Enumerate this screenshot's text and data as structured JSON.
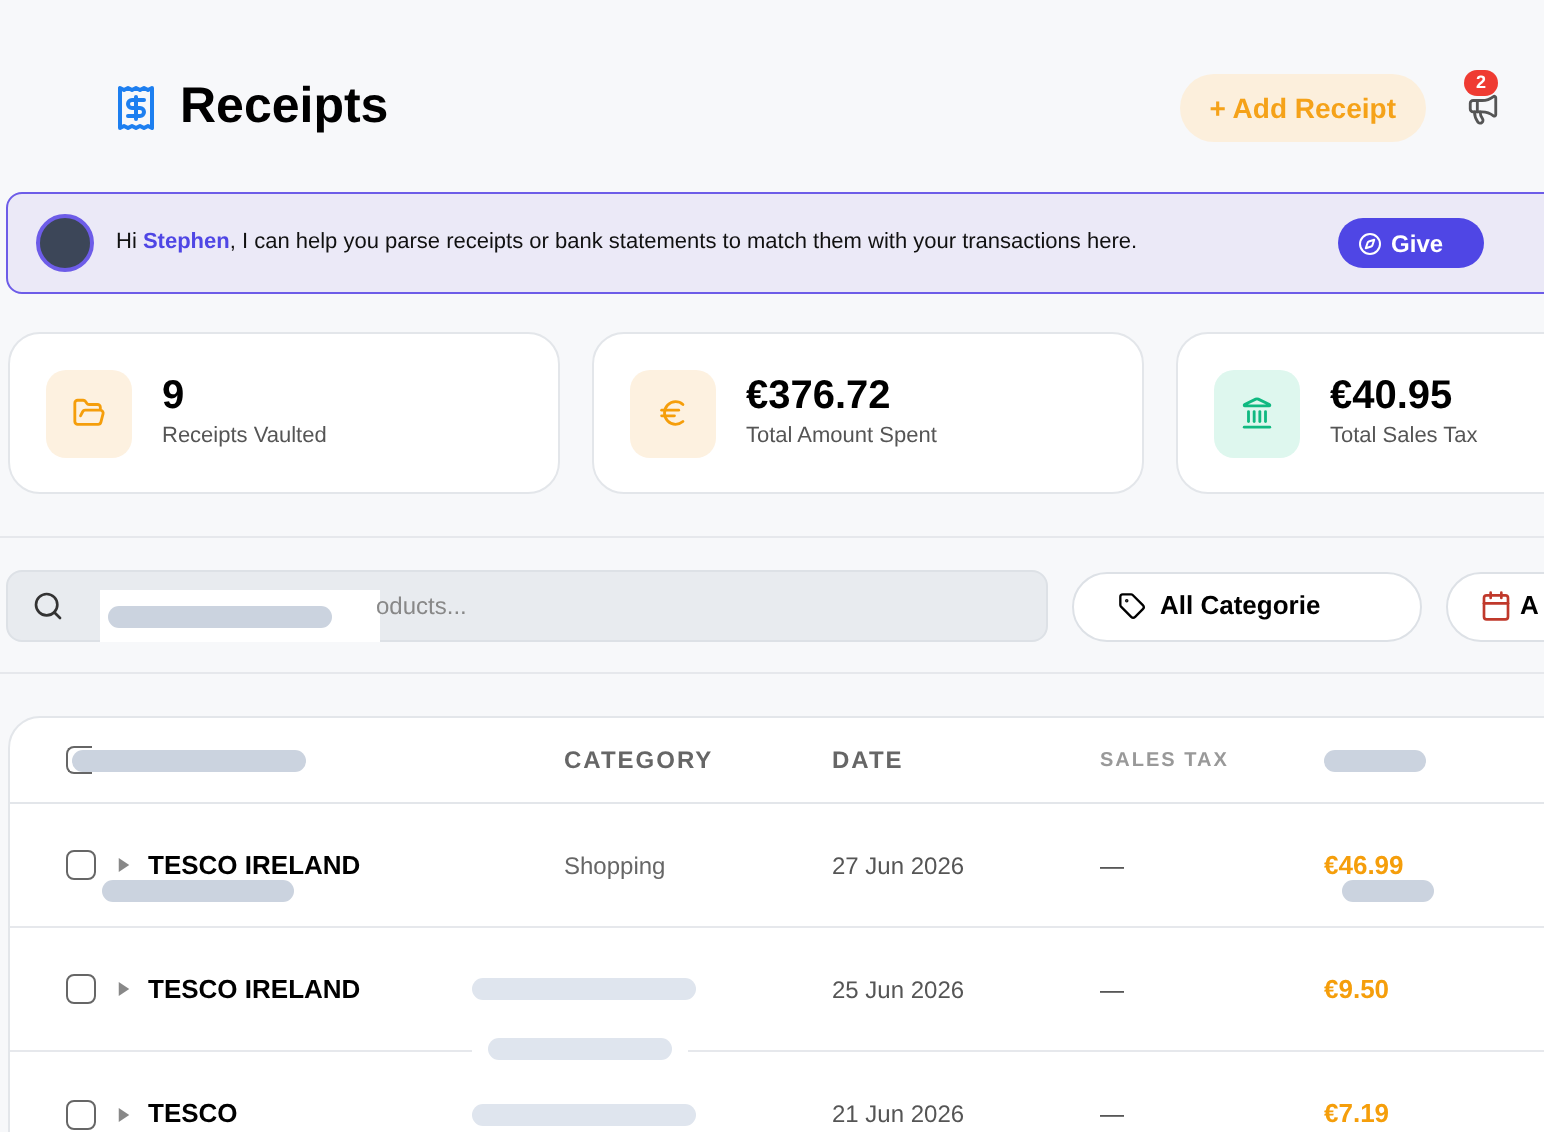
{
  "header": {
    "title": "Receipts",
    "add_button": "+ Add Receipt",
    "notifications": {
      "count": "2"
    }
  },
  "banner": {
    "message": "Hi **Stephen**, I can help you parse receipts or bank statements to match them with your transactions here.",
    "button": "Give"
  },
  "stats": [
    {
      "kind": "folder",
      "value": "9",
      "label": "Receipts Vaulted"
    },
    {
      "kind": "euro",
      "value": "€376.72",
      "label": "Total Amount Spent"
    },
    {
      "kind": "bank",
      "value": "€40.95",
      "label": "Total Sales Tax"
    }
  ],
  "filters": {
    "search": {
      "placeholder": "oducts..."
    },
    "category_button": "All Categorie",
    "date_button": "A"
  },
  "table": {
    "select_all_checked": false,
    "columns": [
      "CATEGORY",
      "DATE",
      "SALES TAX"
    ],
    "rows": [
      {
        "checked": false,
        "name": "TESCO IRELAND",
        "category": "Shopping",
        "date": "27 Jun 2026",
        "sales_tax": "—",
        "amount": "€46.99"
      },
      {
        "checked": false,
        "name": "TESCO IRELAND",
        "date": "25 Jun 2026",
        "sales_tax": "—",
        "amount": "€9.50"
      },
      {
        "checked": false,
        "name": "TESCO",
        "date": "21 Jun 2026",
        "sales_tax": "—",
        "amount": "€7.19"
      }
    ]
  }
}
